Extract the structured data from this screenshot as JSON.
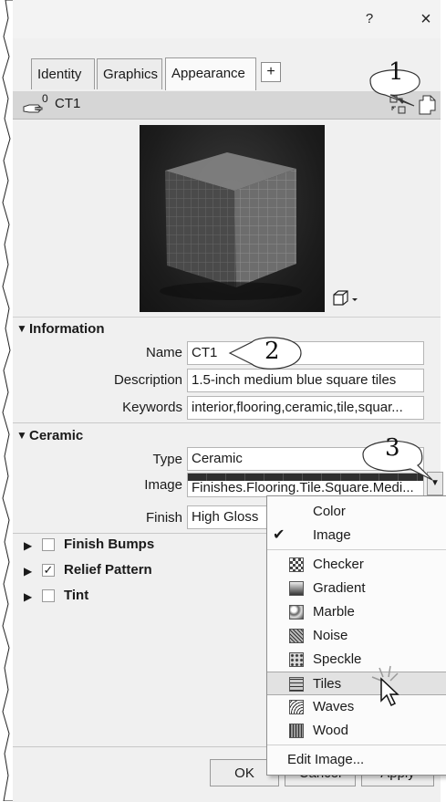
{
  "titlebar": {
    "help": "?",
    "close": "×"
  },
  "tabs": [
    {
      "label": "Identity"
    },
    {
      "label": "Graphics"
    },
    {
      "label": "Appearance"
    }
  ],
  "tab_add": "+",
  "asset": {
    "count": "0",
    "name": "CT1"
  },
  "information": {
    "header": "Information",
    "name_label": "Name",
    "name_value": "CT1",
    "description_label": "Description",
    "description_value": "1.5-inch medium blue square tiles",
    "keywords_label": "Keywords",
    "keywords_value": "interior,flooring,ceramic,tile,squar..."
  },
  "ceramic": {
    "header": "Ceramic",
    "type_label": "Type",
    "type_value": "Ceramic",
    "image_label": "Image",
    "image_value": "Finishes.Flooring.Tile.Square.Medi...",
    "finish_label": "Finish",
    "finish_value": "High Gloss"
  },
  "sections": [
    {
      "label": "Finish Bumps",
      "checked": false
    },
    {
      "label": "Relief Pattern",
      "checked": true
    },
    {
      "label": "Tint",
      "checked": false
    }
  ],
  "menu": {
    "color": "Color",
    "image": "Image",
    "checker": "Checker",
    "gradient": "Gradient",
    "marble": "Marble",
    "noise": "Noise",
    "speckle": "Speckle",
    "tiles": "Tiles",
    "waves": "Waves",
    "wood": "Wood",
    "edit_image": "Edit Image..."
  },
  "footer": {
    "ok": "OK",
    "cancel": "Cancel",
    "apply": "Apply"
  },
  "callouts": {
    "c1": "1",
    "c2": "2",
    "c3": "3"
  }
}
